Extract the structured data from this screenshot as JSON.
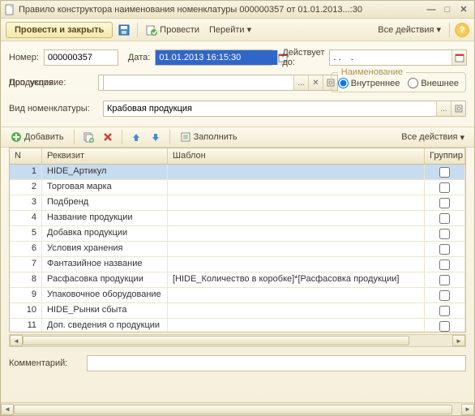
{
  "titlebar": {
    "text": "Правило конструктора наименования номенклатуры 000000357 от 01.01.2013...:30"
  },
  "toolbar": {
    "primary": "Провести и закрыть",
    "post": "Провести",
    "goto": "Перейти",
    "all_actions": "Все действия",
    "help": "?"
  },
  "form": {
    "number_label": "Номер:",
    "number": "000000357",
    "date_label": "Дата:",
    "date": "01.01.2013 16:15:30",
    "valid_label": "Действует до:",
    "valid": ". .    .   ",
    "product_label": "Продукция:",
    "product": "",
    "cond_label": "Доп. условие:",
    "cond": "",
    "naming_title": "Наименование",
    "radio_inner": "Внутреннее",
    "radio_outer": "Внешнее",
    "kind_label": "Вид номенклатуры:",
    "kind": "Крабовая продукция"
  },
  "gridtb": {
    "add": "Добавить",
    "fill": "Заполнить",
    "all_actions": "Все действия"
  },
  "grid": {
    "headers": {
      "n": "N",
      "req": "Реквизит",
      "tpl": "Шаблон",
      "grp": "Группир"
    },
    "rows": [
      {
        "n": 1,
        "req": "HIDE_Артикул",
        "tpl": ""
      },
      {
        "n": 2,
        "req": "Торговая марка",
        "tpl": ""
      },
      {
        "n": 3,
        "req": "Подбренд",
        "tpl": ""
      },
      {
        "n": 4,
        "req": "Название продукции",
        "tpl": ""
      },
      {
        "n": 5,
        "req": "Добавка продукции",
        "tpl": ""
      },
      {
        "n": 6,
        "req": "Условия хранения",
        "tpl": ""
      },
      {
        "n": 7,
        "req": "Фантазийное название",
        "tpl": ""
      },
      {
        "n": 8,
        "req": "Расфасовка продукции",
        "tpl": "[HIDE_Количество в коробке]*[Расфасовка продукции]"
      },
      {
        "n": 9,
        "req": "Упаковочное оборудование",
        "tpl": ""
      },
      {
        "n": 10,
        "req": "HIDE_Рынки сбыта",
        "tpl": ""
      },
      {
        "n": 11,
        "req": "Доп. сведения о продукции",
        "tpl": ""
      }
    ]
  },
  "bottom": {
    "comment_label": "Комментарий:",
    "comment": ""
  }
}
